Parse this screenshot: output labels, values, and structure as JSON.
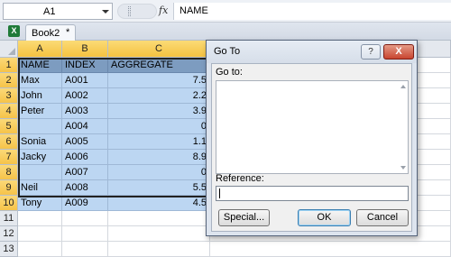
{
  "formula_bar": {
    "name_box": "A1",
    "fx_icon": "fx",
    "content": "NAME"
  },
  "workbook": {
    "icon": "X",
    "tab_label": "Book2",
    "dirty_marker": "*"
  },
  "sheet": {
    "columns": [
      "A",
      "B",
      "C"
    ],
    "rows": [
      "1",
      "2",
      "3",
      "4",
      "5",
      "6",
      "7",
      "8",
      "9",
      "10",
      "11",
      "12",
      "13"
    ],
    "header_row": [
      "NAME",
      "INDEX",
      "AGGREGATE"
    ],
    "data_rows": [
      [
        "Max",
        "A001",
        "7.5"
      ],
      [
        "John",
        "A002",
        "2.2"
      ],
      [
        "Peter",
        "A003",
        "3.9"
      ],
      [
        "",
        "A004",
        "0"
      ],
      [
        "Sonia",
        "A005",
        "1.1"
      ],
      [
        "Jacky",
        "A006",
        "8.9"
      ],
      [
        "",
        "A007",
        "0"
      ],
      [
        "Neil",
        "A008",
        "5.5"
      ],
      [
        "Tony",
        "A009",
        "4.5"
      ]
    ]
  },
  "dialog": {
    "title": "Go To",
    "help_label": "?",
    "close_label": "X",
    "goto_label": "Go to:",
    "reference_label": "Reference:",
    "reference_value": "",
    "buttons": {
      "special": "Special...",
      "ok": "OK",
      "cancel": "Cancel"
    }
  }
}
